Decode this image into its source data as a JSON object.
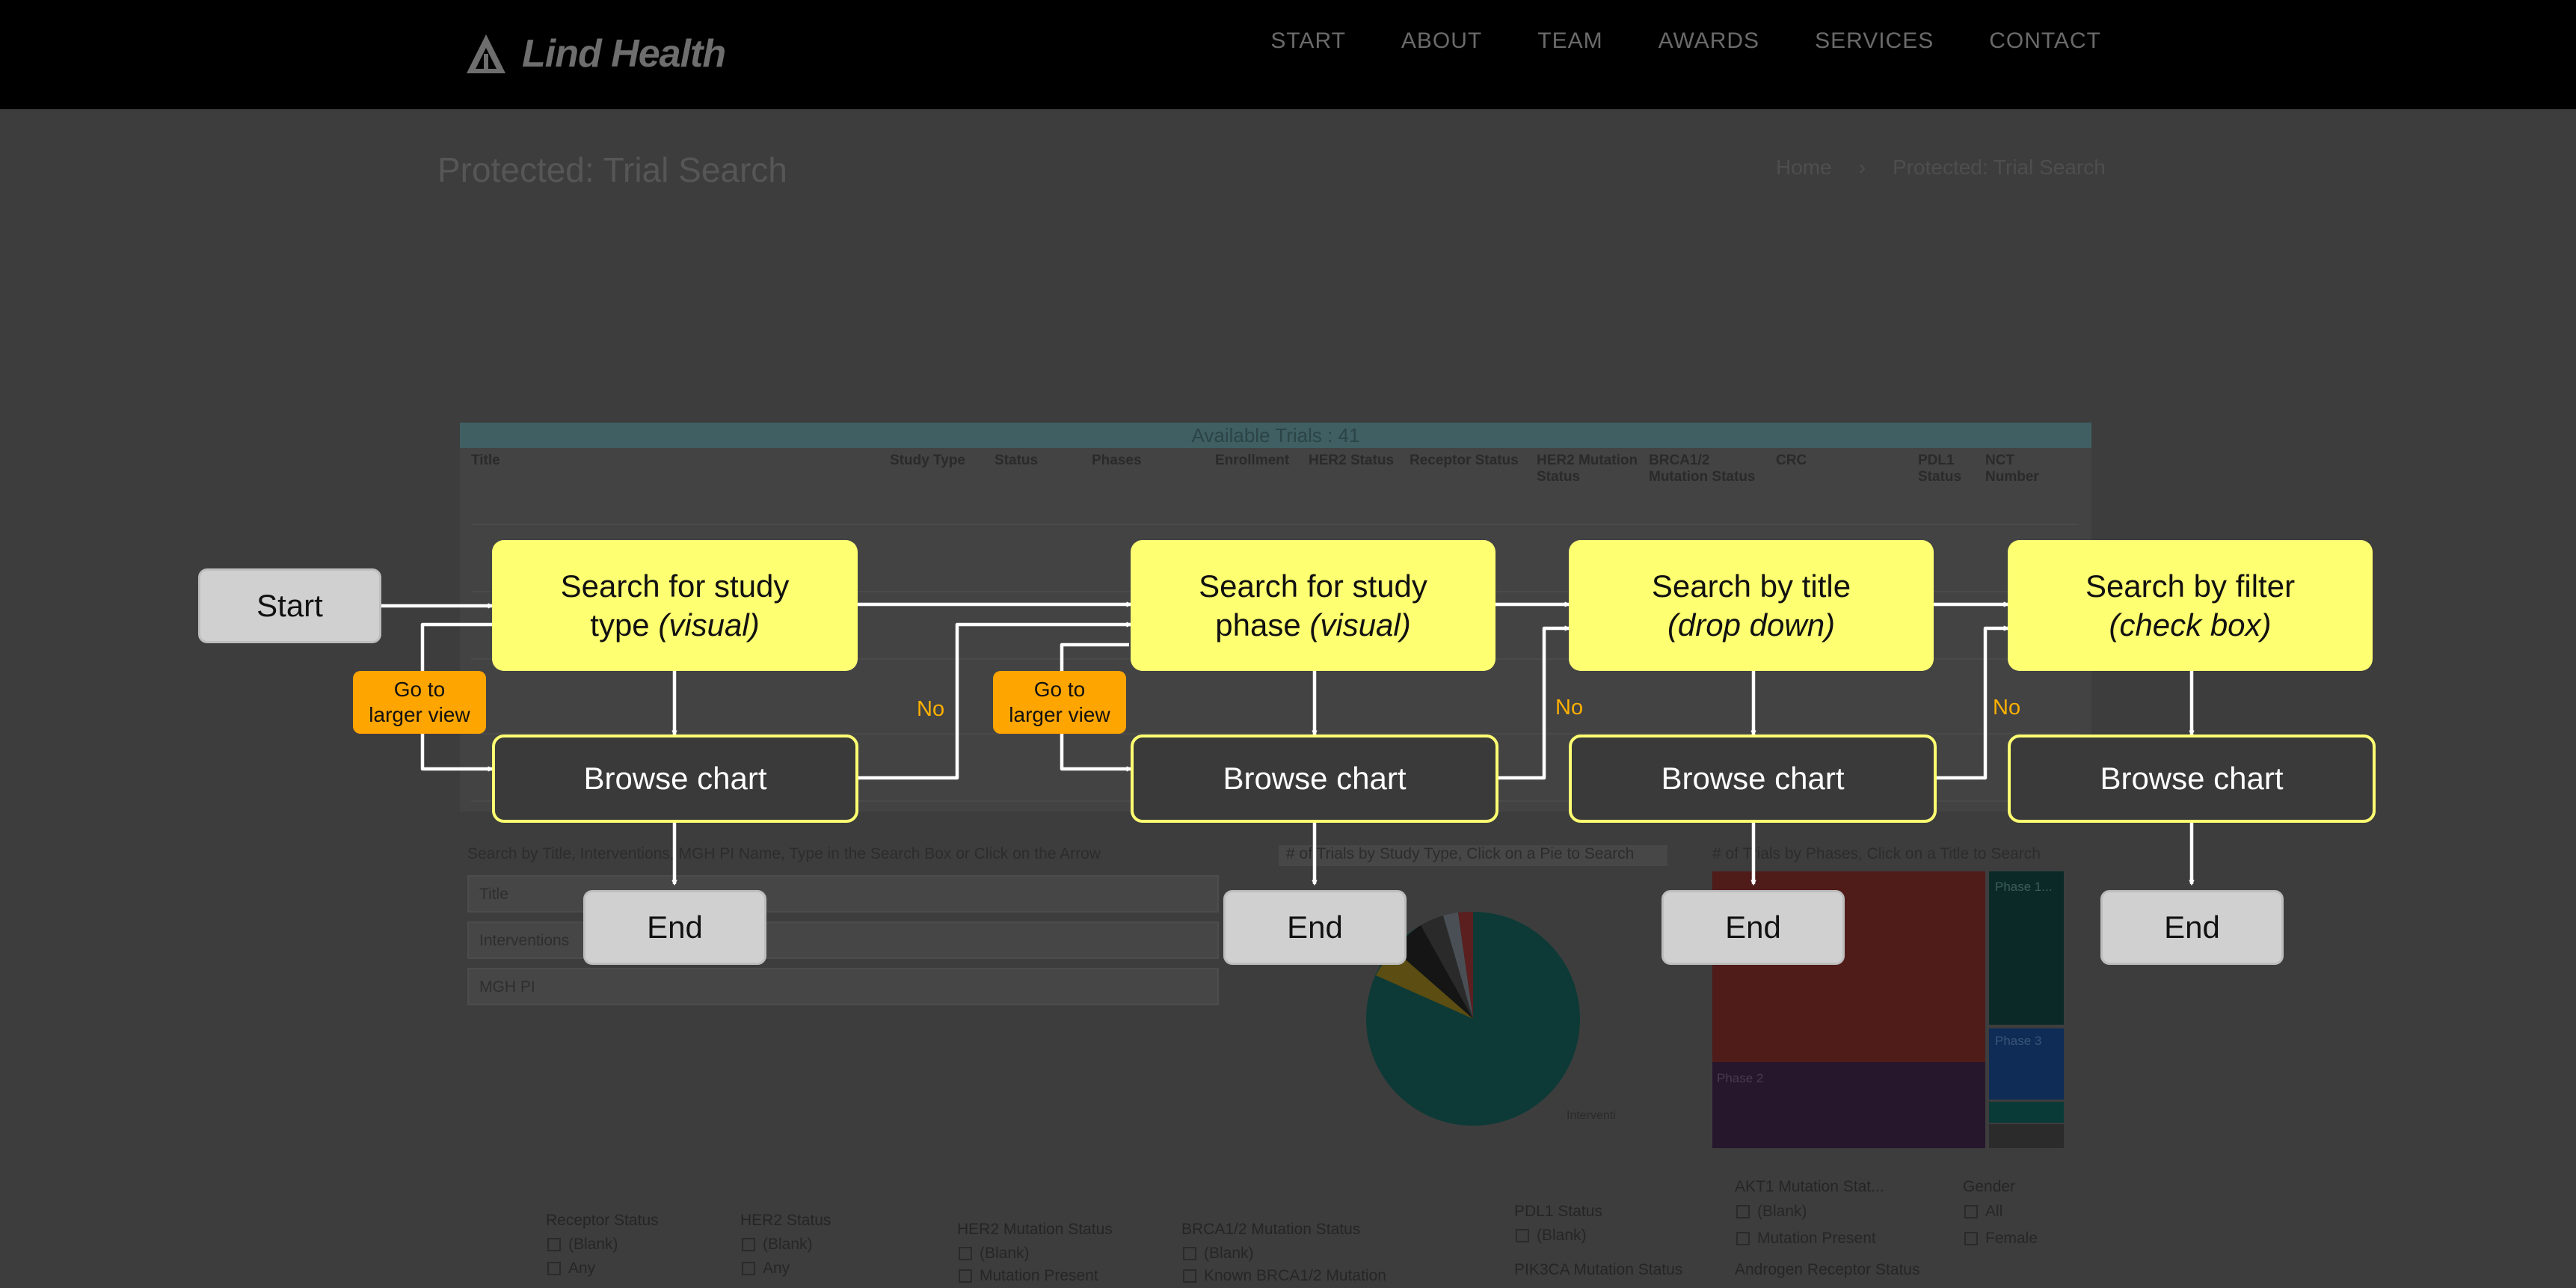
{
  "site": {
    "logo_text": "Lind Health",
    "nav": [
      "START",
      "ABOUT",
      "TEAM",
      "AWARDS",
      "SERVICES",
      "CONTACT"
    ],
    "page_title": "Protected: Trial Search",
    "breadcrumb": [
      "Home",
      "›",
      "Protected: Trial Search"
    ]
  },
  "report": {
    "title_bar": "Available Trials :     41",
    "headers": [
      "Title",
      "Study Type",
      "Status",
      "Phases",
      "Enrollment",
      "HER2 Status",
      "Receptor Status",
      "HER2 Mutation Status",
      "BRCA1/2 Mutation Status",
      "CRC",
      "PDL1 Status",
      "NCT Number"
    ],
    "search_caption": "Search by Title, Interventions, MGH PI Name, Type in the Search Box or Click on the Arrow",
    "dropdowns": [
      "Title",
      "Interventions",
      "MGH PI"
    ],
    "pie_caption": "# of Trials by Study Type, Click on a Pie to Search",
    "pie_label": "Interventional",
    "treemap_caption": "# of Trials by Phases, Click on a Title to Search",
    "treemap_labels": [
      "Phase 1...",
      "Phase 2",
      "Phase 3"
    ],
    "filters": [
      {
        "label": "Receptor Status",
        "options": [
          "(Blank)",
          "Any"
        ]
      },
      {
        "label": "HER2 Status",
        "options": [
          "(Blank)",
          "Any"
        ]
      },
      {
        "label": "HER2 Mutation Status",
        "options": [
          "(Blank)",
          "Mutation Present"
        ]
      },
      {
        "label": "BRCA1/2 Mutation Status",
        "options": [
          "(Blank)",
          "Known BRCA1/2 Mutation"
        ]
      },
      {
        "label": "PDL1 Status",
        "options": [
          "(Blank)"
        ]
      },
      {
        "label": "PIK3CA Mutation Status",
        "options": []
      },
      {
        "label": "AKT1 Mutation Stat...",
        "options": [
          "(Blank)",
          "Mutation Present"
        ]
      },
      {
        "label": "Androgen Receptor Status",
        "options": []
      },
      {
        "label": "Gender",
        "options": [
          "All",
          "Female"
        ]
      }
    ]
  },
  "flow": {
    "start": "Start",
    "searches": [
      {
        "line1": "Search for study",
        "line2_plain": "type ",
        "line2_italic": "(visual)"
      },
      {
        "line1": "Search for study",
        "line2_plain": "phase ",
        "line2_italic": "(visual)"
      },
      {
        "line1": "Search by title",
        "line2_plain": "",
        "line2_italic": "(drop down)"
      },
      {
        "line1": "Search by filter",
        "line2_plain": "",
        "line2_italic": "(check box)"
      }
    ],
    "browse": [
      "Browse chart",
      "Browse chart",
      "Browse chart",
      "Browse chart"
    ],
    "ends": [
      "End",
      "End",
      "End",
      "End"
    ],
    "goto": [
      {
        "line1": "Go to",
        "line2": "larger view"
      },
      {
        "line1": "Go to",
        "line2": "larger view"
      }
    ],
    "no_labels": [
      "No",
      "No",
      "No"
    ],
    "colors": {
      "search": "#ffff72",
      "goto": "#ffa500",
      "no_label": "#ffb000",
      "terminal": "#d0d0d0"
    }
  }
}
